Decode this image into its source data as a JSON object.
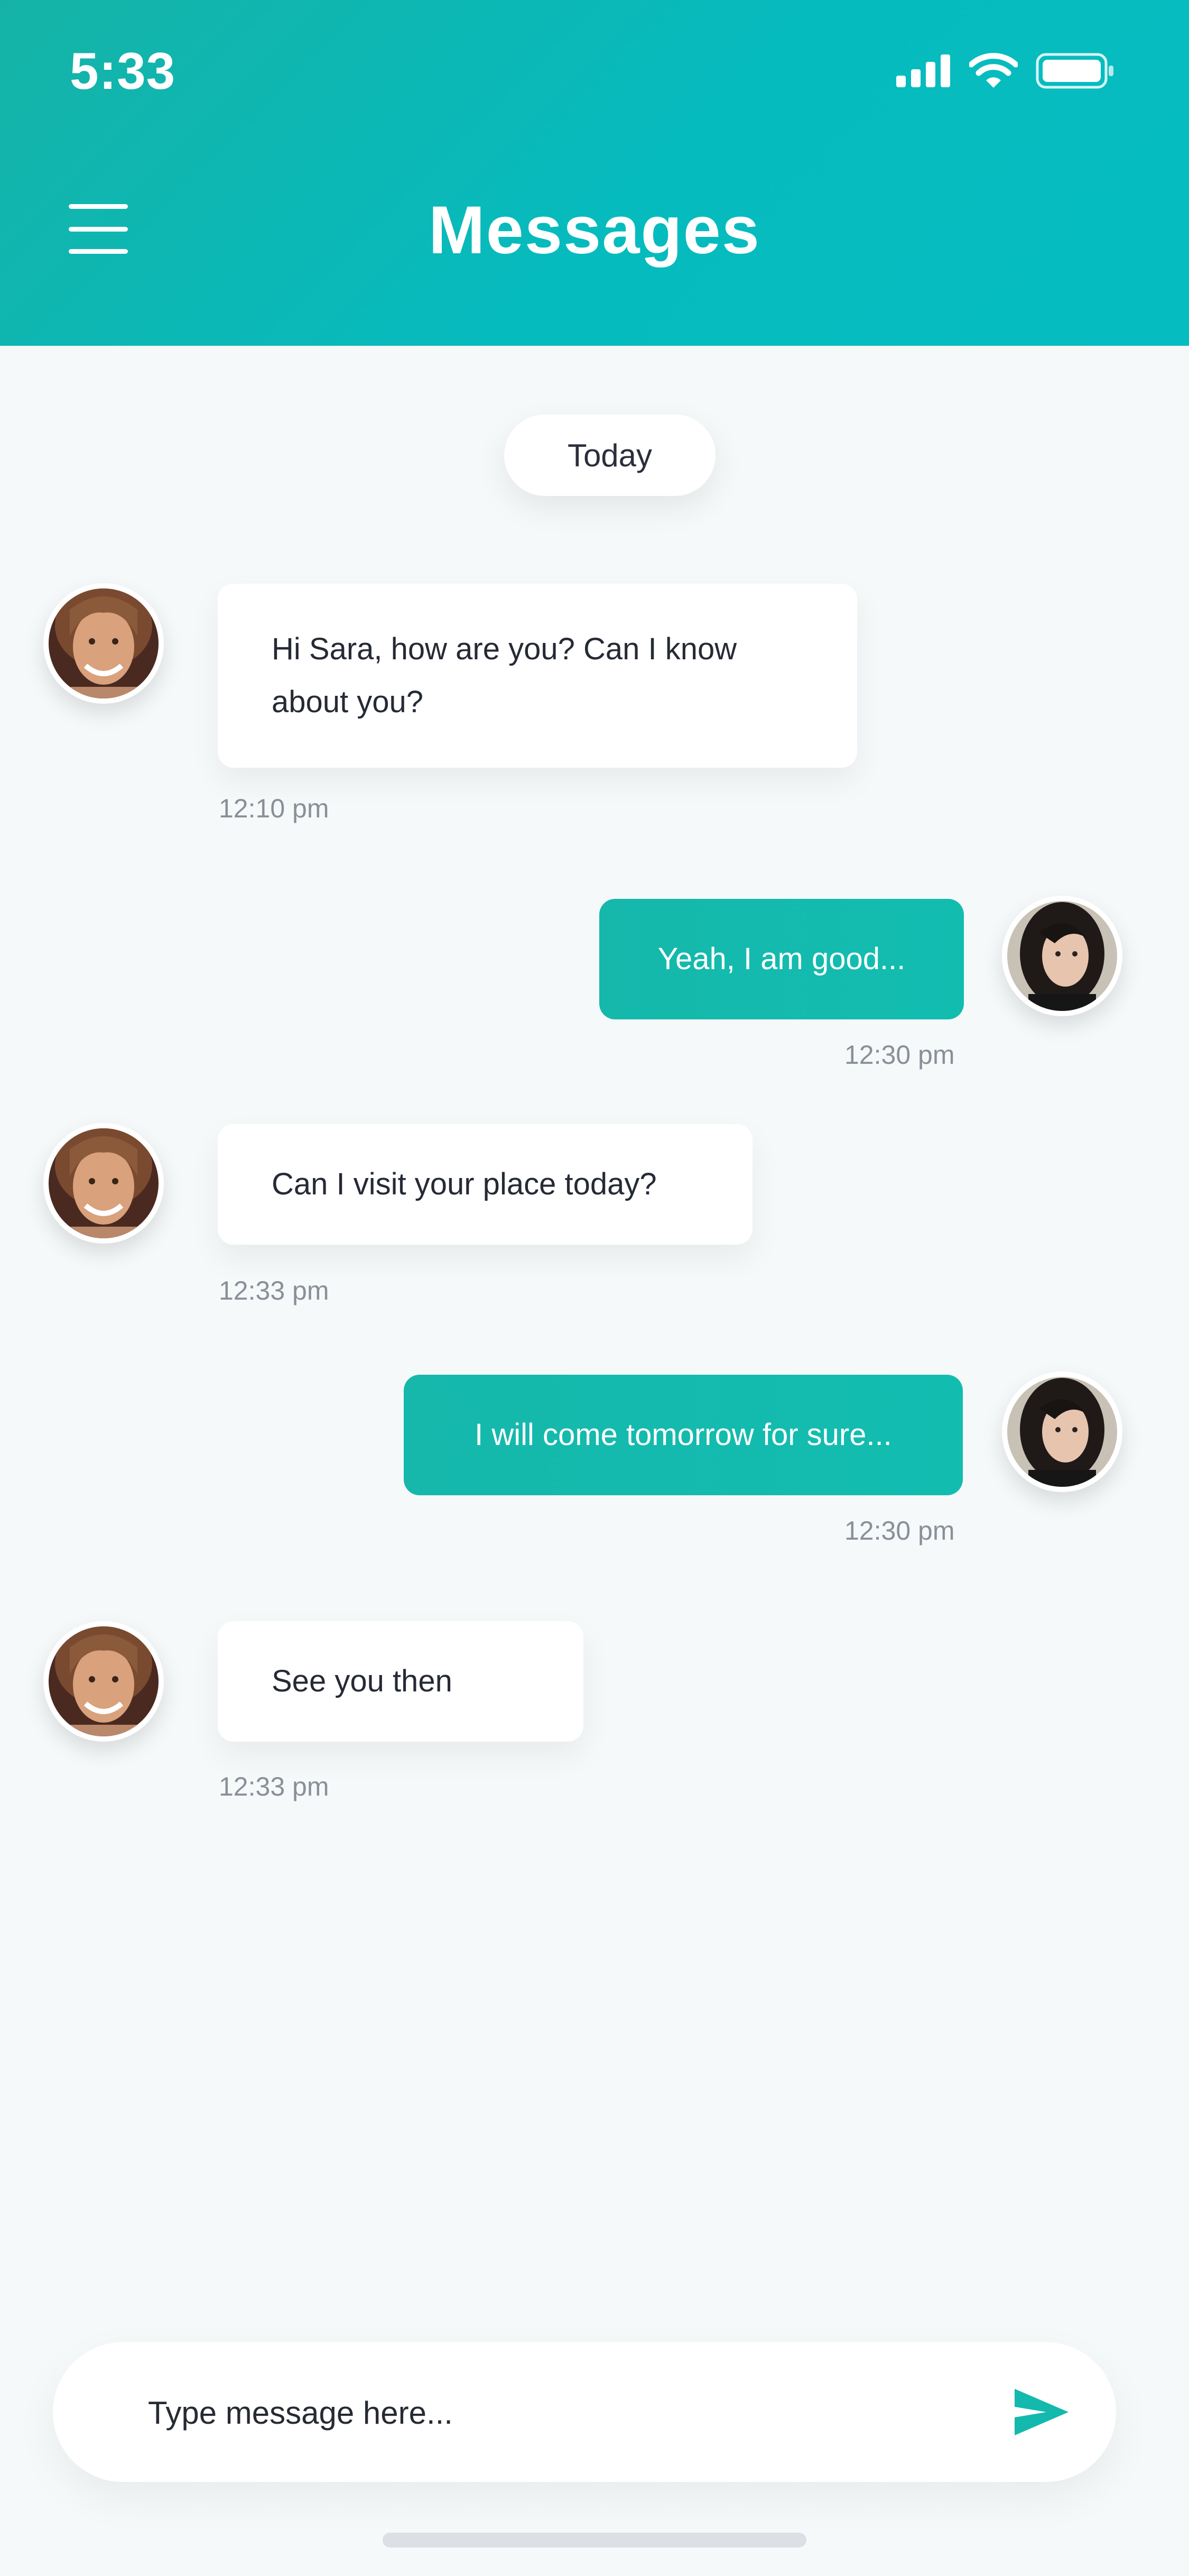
{
  "status_bar": {
    "time": "5:33",
    "icons": [
      "signal-icon",
      "wifi-icon",
      "battery-icon"
    ]
  },
  "header": {
    "title": "Messages",
    "menu_icon": "hamburger-menu-icon",
    "gradient": [
      "#15b3a7",
      "#05bdc1"
    ]
  },
  "date_divider": {
    "label": "Today"
  },
  "messages": [
    {
      "direction": "incoming",
      "line1": "Hi Sara, how are you? Can I know",
      "line2": "about you?",
      "time": "12:10 pm"
    },
    {
      "direction": "outgoing",
      "text": "Yeah, I am good...",
      "time": "12:30 pm"
    },
    {
      "direction": "incoming",
      "text": "Can I visit your place today?",
      "time": "12:33 pm"
    },
    {
      "direction": "outgoing",
      "text": "I will come tomorrow for sure...",
      "time": "12:30 pm"
    },
    {
      "direction": "incoming",
      "text": "See you then",
      "time": "12:33 pm"
    }
  ],
  "composer": {
    "placeholder": "Type message here...",
    "send_icon": "send-icon"
  },
  "colors": {
    "accent": "#13b9ad",
    "background": "#f6f9fa",
    "timestamp": "#8a8f98"
  }
}
